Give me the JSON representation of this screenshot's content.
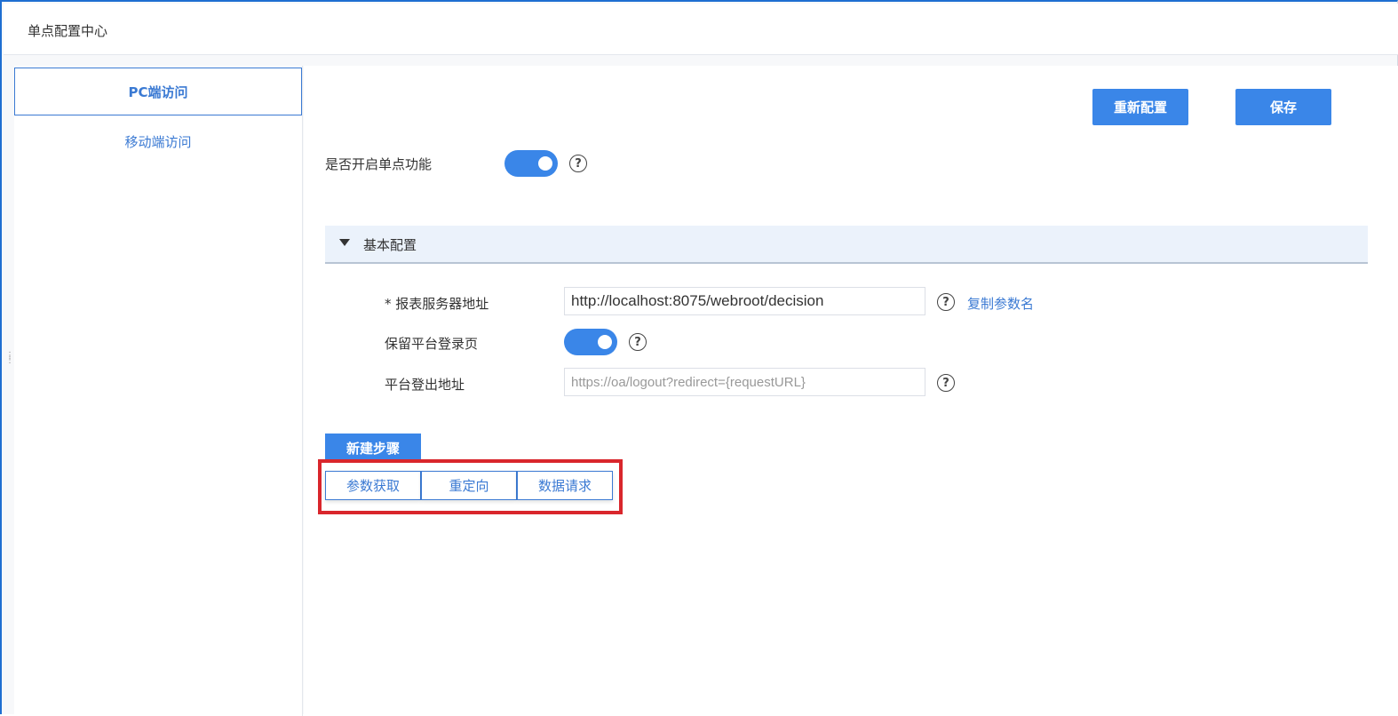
{
  "header": {
    "title": "单点配置中心"
  },
  "sidebar": {
    "items": [
      {
        "label": "PC端访问",
        "active": true
      },
      {
        "label": "移动端访问",
        "active": false
      }
    ]
  },
  "toolbar": {
    "reconfigure_label": "重新配置",
    "save_label": "保存"
  },
  "sso": {
    "enable_label": "是否开启单点功能",
    "enabled": true
  },
  "basic_config": {
    "title": "基本配置",
    "server_address": {
      "label": "* 报表服务器地址",
      "value": "http://localhost:8075/webroot/decision",
      "copy_link": "复制参数名"
    },
    "keep_login": {
      "label": "保留平台登录页",
      "enabled": true
    },
    "logout_address": {
      "label": "平台登出地址",
      "placeholder": "https://oa/logout?redirect={requestURL}"
    }
  },
  "new_step": {
    "label": "新建步骤",
    "options": [
      "参数获取",
      "重定向",
      "数据请求"
    ]
  },
  "colors": {
    "accent": "#3a86e8",
    "highlight": "#d9262c"
  },
  "icons": {
    "help": "?"
  }
}
